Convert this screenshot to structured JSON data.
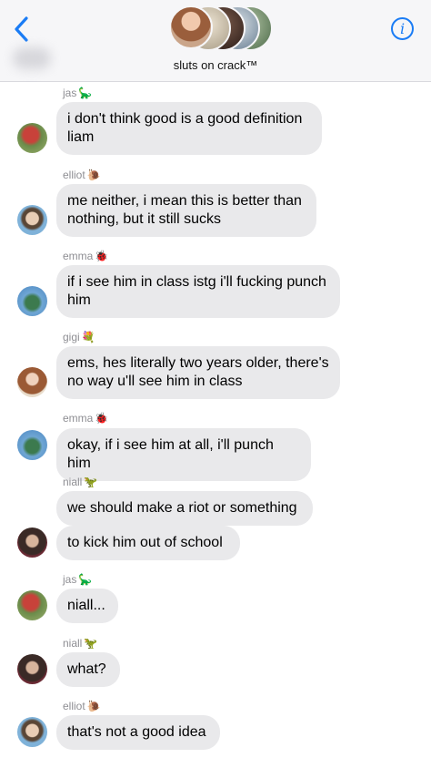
{
  "header": {
    "group_name": "sluts on crack™",
    "info_glyph": "i",
    "back_glyph": "‹"
  },
  "messages": [
    {
      "sender": "jas",
      "sender_emoji": "🦕",
      "text": "i don't think good is a good definition liam",
      "avatar": "avatar-jas"
    },
    {
      "sender": "elliot",
      "sender_emoji": "🐌",
      "text": "me neither, i mean this is better than nothing, but it still sucks",
      "avatar": "avatar-elliot"
    },
    {
      "sender": "emma",
      "sender_emoji": "🐞",
      "text": "if i see him in class istg i'll fucking punch him",
      "avatar": "avatar-emma"
    },
    {
      "sender": "gigi",
      "sender_emoji": "💐",
      "text": "ems, hes literally two years older, there's no way u'll see him in class",
      "avatar": "avatar-gigi"
    },
    {
      "sender": "emma",
      "sender_emoji": "🐞",
      "text": "okay, if i see him at all, i'll punch him",
      "avatar": "avatar-emma"
    },
    {
      "sender": "niall",
      "sender_emoji": "🦖",
      "text": "we should make a riot or something",
      "avatar": ""
    },
    {
      "sender": "",
      "sender_emoji": "",
      "text": "to kick him out of school",
      "avatar": "avatar-niall"
    },
    {
      "sender": "jas",
      "sender_emoji": "🦕",
      "text": "niall...",
      "avatar": "avatar-jas"
    },
    {
      "sender": "niall",
      "sender_emoji": "🦖",
      "text": "what?",
      "avatar": "avatar-niall"
    },
    {
      "sender": "elliot",
      "sender_emoji": "🐌",
      "text": "that's not a good idea",
      "avatar": "avatar-elliot"
    }
  ],
  "colors": {
    "accent": "#1a7cf5",
    "bubble_gray": "#e9e9eb",
    "header_bg": "#f6f6f8",
    "sender_gray": "#8e8e93"
  }
}
